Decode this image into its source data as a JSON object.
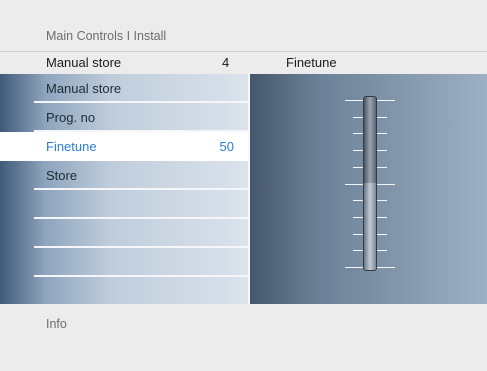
{
  "breadcrumb": "Main Controls I Install",
  "header": {
    "label": "Manual store",
    "value": "4",
    "panel_title": "Finetune"
  },
  "menu": {
    "items": [
      {
        "label": "Manual store",
        "value": ""
      },
      {
        "label": "Prog. no",
        "value": ""
      },
      {
        "label": "Finetune",
        "value": "50",
        "selected": true
      },
      {
        "label": "Store",
        "value": ""
      },
      {
        "label": "",
        "value": ""
      },
      {
        "label": "",
        "value": ""
      },
      {
        "label": "",
        "value": ""
      },
      {
        "label": "",
        "value": ""
      }
    ]
  },
  "finetune_slider": {
    "level": 0.5
  },
  "info": "Info",
  "colors": {
    "selected_text": "#2a7fd4",
    "panel_dark": "#44566c",
    "panel_light": "#9db0c3"
  }
}
